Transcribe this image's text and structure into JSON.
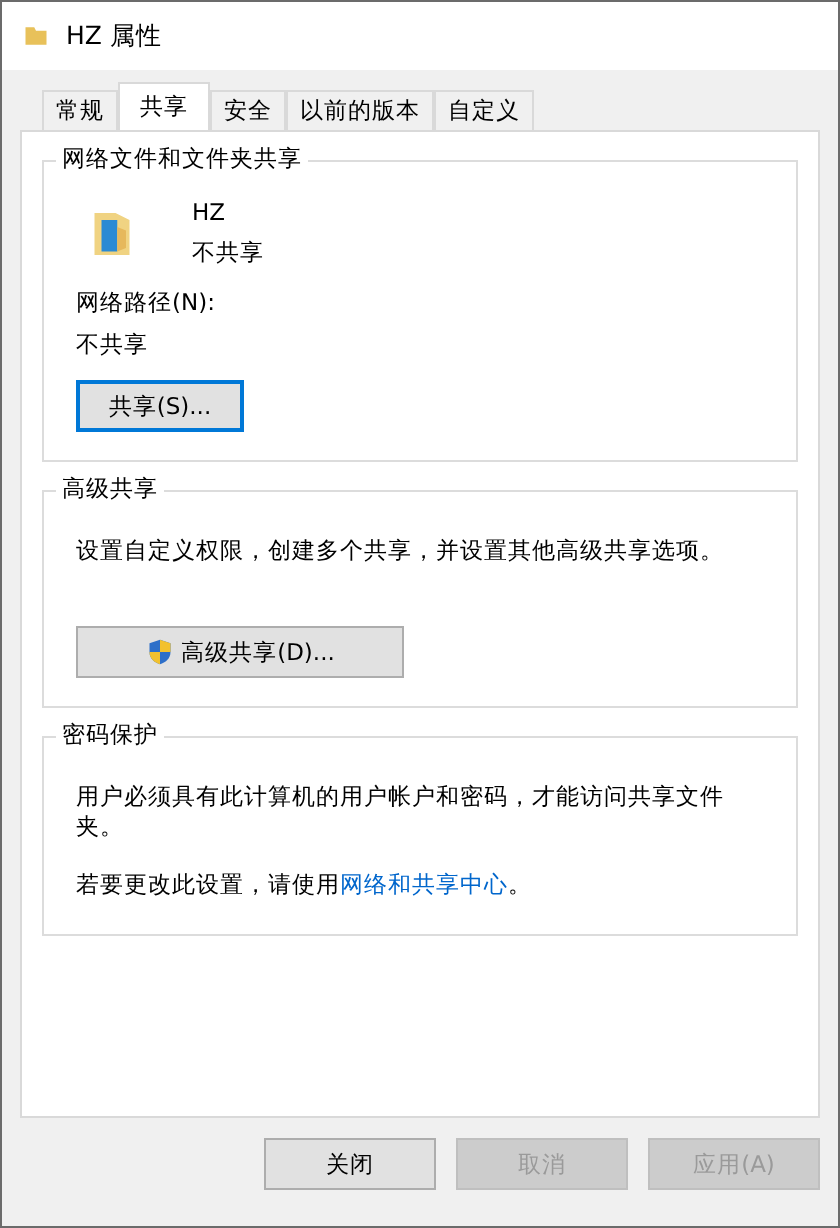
{
  "window": {
    "title": "HZ 属性"
  },
  "tabs": [
    {
      "label": "常规",
      "selected": false
    },
    {
      "label": "共享",
      "selected": true
    },
    {
      "label": "安全",
      "selected": false
    },
    {
      "label": "以前的版本",
      "selected": false
    },
    {
      "label": "自定义",
      "selected": false
    }
  ],
  "network_sharing": {
    "title": "网络文件和文件夹共享",
    "folder_name": "HZ",
    "folder_status": "不共享",
    "path_label": "网络路径(N):",
    "path_value": "不共享",
    "share_button": "共享(S)..."
  },
  "advanced_sharing": {
    "title": "高级共享",
    "description": "设置自定义权限，创建多个共享，并设置其他高级共享选项。",
    "button": "高级共享(D)..."
  },
  "password_protection": {
    "title": "密码保护",
    "description": "用户必须具有此计算机的用户帐户和密码，才能访问共享文件夹。",
    "hint_prefix": "若要更改此设置，请使用",
    "link": "网络和共享中心",
    "hint_suffix": "。"
  },
  "buttons": [
    {
      "label": "关闭",
      "disabled": false
    },
    {
      "label": "取消",
      "disabled": true
    },
    {
      "label": "应用(A)",
      "disabled": true
    }
  ]
}
